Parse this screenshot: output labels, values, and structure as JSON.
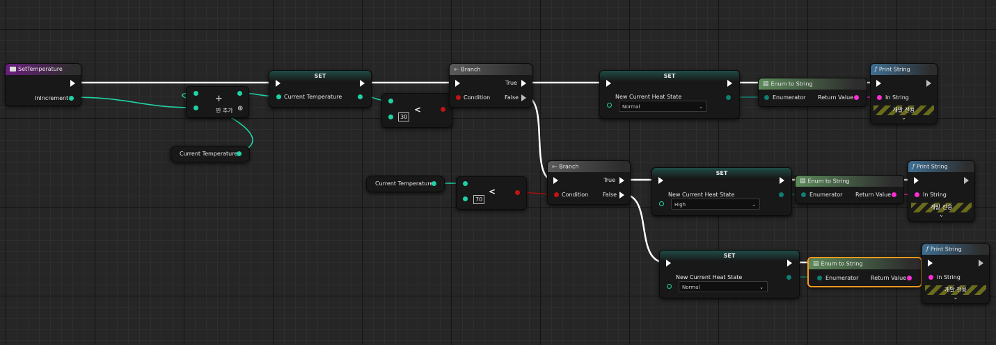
{
  "colors": {
    "exec": "#ffffff",
    "float": "#1fd3a6",
    "bool": "#c21414",
    "string": "#ff2ed3",
    "byte": "#0f7f72",
    "selected": "#ff9a1f"
  },
  "event": {
    "title": "SetTemperature",
    "param": "InIncrement"
  },
  "add": {
    "symbol": "+",
    "add_pin": "핀 추가"
  },
  "var_get_1": {
    "label": "Current Temperature"
  },
  "var_get_2": {
    "label": "Current Temperature"
  },
  "set_temp": {
    "title": "SET",
    "pin": "Current Temperature"
  },
  "less1": {
    "symbol": "<",
    "value": "30"
  },
  "less2": {
    "symbol": "<",
    "value": "70"
  },
  "branch1": {
    "title": "Branch",
    "condition": "Condition",
    "true_label": "True",
    "false_label": "False"
  },
  "branch2": {
    "title": "Branch",
    "condition": "Condition",
    "true_label": "True",
    "false_label": "False"
  },
  "set_state1": {
    "title": "SET",
    "pin": "New Current Heat State",
    "value": "Normal"
  },
  "set_state2": {
    "title": "SET",
    "pin": "New Current Heat State",
    "value": "High"
  },
  "set_state3": {
    "title": "SET",
    "pin": "New Current Heat State",
    "value": "Normal"
  },
  "enum1": {
    "title": "Enum to String",
    "input": "Enumerator",
    "output": "Return Value"
  },
  "enum2": {
    "title": "Enum to String",
    "input": "Enumerator",
    "output": "Return Value"
  },
  "enum3": {
    "title": "Enum to String",
    "input": "Enumerator",
    "output": "Return Value"
  },
  "print1": {
    "title": "Print String",
    "in_string": "In String",
    "dev_only": "개발 전용"
  },
  "print2": {
    "title": "Print String",
    "in_string": "In String",
    "dev_only": "개발 전용"
  },
  "print3": {
    "title": "Print String",
    "in_string": "In String",
    "dev_only": "개발 전용"
  }
}
